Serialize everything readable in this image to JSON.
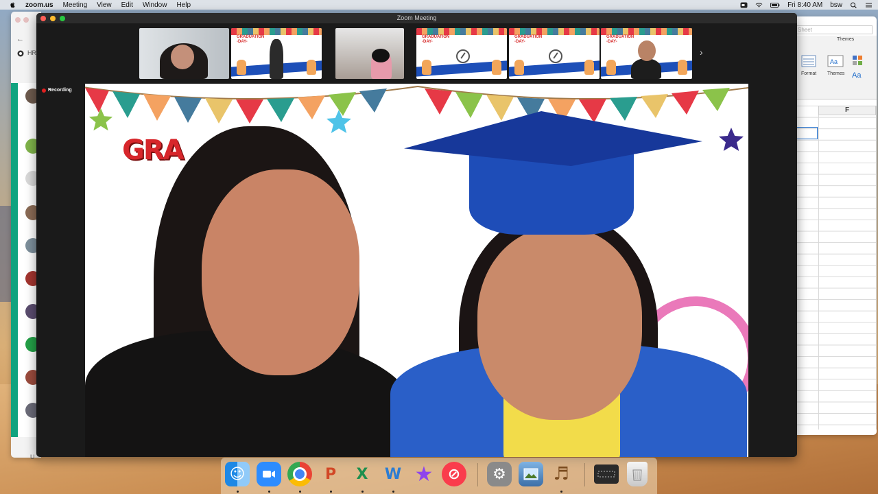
{
  "menubar": {
    "app_name": "zoom.us",
    "menus": [
      "Meeting",
      "View",
      "Edit",
      "Window",
      "Help"
    ],
    "clock": "Fri 8:40 AM",
    "user": "bsw"
  },
  "browser": {
    "tab_text": "HR",
    "footer_text": "U"
  },
  "excel": {
    "search_placeholder": "Sheet",
    "themes_group_label": "Themes",
    "format_label": "Format",
    "themes_label": "Themes",
    "column_header": "F"
  },
  "zoom": {
    "window_title": "Zoom Meeting",
    "recording_label": "Recording",
    "graduation_banner": "GRA",
    "thumbnail_banner": "GRADUATION\n-DAY-"
  },
  "colors": {
    "zoom_bg": "#1a1a1a",
    "recording_red": "#e02020",
    "cap_blue": "#17389a",
    "grad_red": "#d7262b"
  },
  "dock": {
    "icons": [
      "finder-icon",
      "zoom-icon",
      "chrome-icon",
      "powerpoint-icon",
      "excel-icon",
      "word-icon",
      "imovie-icon",
      "news-icon",
      "system-preferences-icon",
      "preview-icon",
      "garageband-icon",
      "screenshot-icon",
      "trash-icon"
    ]
  }
}
